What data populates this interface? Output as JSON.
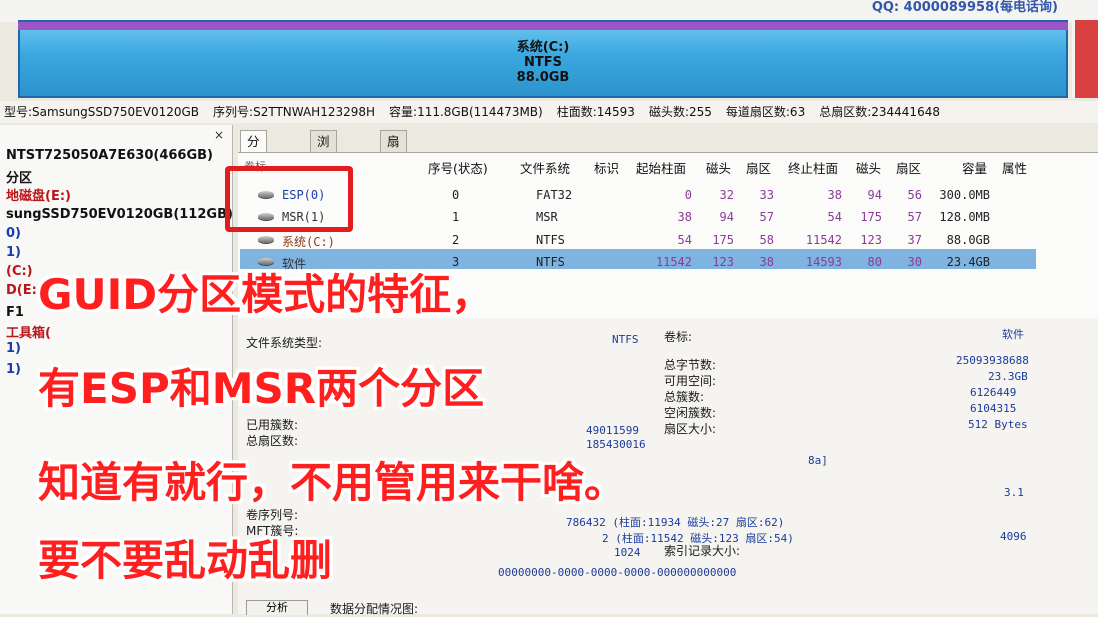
{
  "top": {
    "qq_text": "QQ: 4000089958(每电话询)"
  },
  "partition_bar": {
    "name": "系统(C:)",
    "fs": "NTFS",
    "size": "88.0GB"
  },
  "disk_info": {
    "model": "型号:SamsungSSD750EV0120GB",
    "serial": "序列号:S2TTNWAH123298H",
    "capacity": "容量:111.8GB(114473MB)",
    "cylinders": "柱面数:14593",
    "heads": "磁头数:255",
    "sectors_per_track": "每道扇区数:63",
    "total_sectors": "总扇区数:234441648"
  },
  "tree": {
    "close": "×",
    "items": [
      {
        "text": "NTST725050A7E630(466GB)",
        "color": "#111111"
      },
      {
        "text": "分区",
        "color": "#111111"
      },
      {
        "text": "地磁盘(E:)",
        "color": "#b8161a"
      },
      {
        "text": "sungSSD750EV0120GB(112GB)",
        "color": "#111111"
      },
      {
        "text": "0)",
        "color": "#1a3da8"
      },
      {
        "text": "1)",
        "color": "#1a3da8"
      },
      {
        "text": "(C:)",
        "color": "#b8161a"
      },
      {
        "text": "D(E:)",
        "color": "#b8161a"
      },
      {
        "text": "F1",
        "color": "#111111"
      },
      {
        "text": "工具箱(",
        "color": "#b8161a"
      },
      {
        "text": "1)",
        "color": "#1a3da8"
      },
      {
        "text": "1)",
        "color": "#1a3da8"
      }
    ]
  },
  "tabs": [
    "分区参数",
    "浏览文件",
    "扇区编辑"
  ],
  "table": {
    "headers": [
      "卷标",
      "序号(状态)",
      "文件系统",
      "标识",
      "起始柱面",
      "磁头",
      "扇区",
      "终止柱面",
      "磁头",
      "扇区",
      "容量",
      "属性"
    ],
    "rows": [
      {
        "name": "ESP(0)",
        "index": "0",
        "fs": "FAT32",
        "start_cyl": "0",
        "start_head": "32",
        "start_sec": "33",
        "end_cyl": "38",
        "end_head": "94",
        "end_sec": "56",
        "capacity": "300.0MB"
      },
      {
        "name": "MSR(1)",
        "index": "1",
        "fs": "MSR",
        "start_cyl": "38",
        "start_head": "94",
        "start_sec": "57",
        "end_cyl": "54",
        "end_head": "175",
        "end_sec": "57",
        "capacity": "128.0MB"
      },
      {
        "name": "系统(C:)",
        "index": "2",
        "fs": "NTFS",
        "start_cyl": "54",
        "start_head": "175",
        "start_sec": "58",
        "end_cyl": "11542",
        "end_head": "123",
        "end_sec": "37",
        "capacity": "88.0GB"
      },
      {
        "name": "软件",
        "index": "3",
        "fs": "NTFS",
        "start_cyl": "11542",
        "start_head": "123",
        "start_sec": "38",
        "end_cyl": "14593",
        "end_head": "80",
        "end_sec": "30",
        "capacity": "23.4GB"
      }
    ]
  },
  "details": {
    "fs_type_label": "文件系统类型:",
    "fs_type_value": "NTFS",
    "volume_label": "卷标:",
    "volume_value": "软件",
    "total_bytes_label": "总字节数:",
    "total_bytes_value": "25093938688",
    "free_space_label": "可用空间:",
    "free_space_value": "23.3GB",
    "total_clusters_label": "总簇数:",
    "total_clusters_value": "6126449",
    "free_clusters_label": "空闲簇数:",
    "free_clusters_value": "6104315",
    "sector_size_label": "扇区大小:",
    "sector_size_value": "512 Bytes",
    "used_clusters_label": "已用簇数:",
    "used_clusters_value": "49011599",
    "total_sectors_label": "总扇区数:",
    "total_sectors_value": "185430016",
    "bracket_fragment": "8a]",
    "version_value": "3.1",
    "serial_label": "卷序列号:",
    "mft_label": "MFT簇号:",
    "mft_value": "786432 (柱面:11934 磁头:27 扇区:62)",
    "mftmirr_value": "2 (柱面:11542 磁头:123 扇区:54)",
    "record_size_value": "1024",
    "index_size_label": "索引记录大小:",
    "index_size_value": "4096",
    "guid_value": "00000000-0000-0000-0000-000000000000",
    "analyze_label": "分析",
    "alloc_label": "数据分配情况图:"
  },
  "overlay": {
    "line1": "GUID分区模式的特征，",
    "line2": "有ESP和MSR两个分区",
    "line3": "知道有就行，不用管用来干啥。",
    "line4": "要不要乱动乱删"
  }
}
